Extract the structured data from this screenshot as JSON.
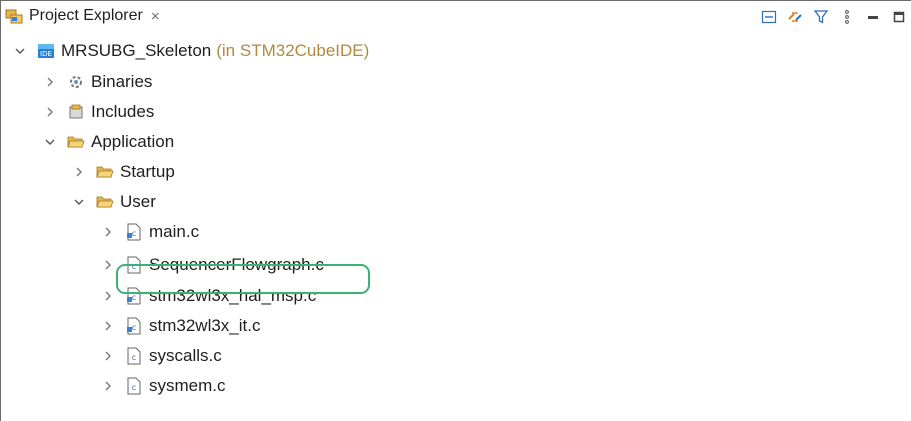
{
  "view": {
    "tab_label": "Project Explorer",
    "close_glyph": "×",
    "tab_icon": "project-explorer-icon",
    "toolbar": [
      "collapse-all-icon",
      "link-with-editor-icon",
      "filter-icon",
      "view-menu-icon",
      "minimize-icon",
      "maximize-icon"
    ]
  },
  "tree": {
    "project": {
      "label": "MRSUBG_Skeleton",
      "qualifier": "(in STM32CubeIDE)",
      "expanded": true
    },
    "items": [
      {
        "label": "Binaries",
        "icon": "binaries-icon",
        "expanded": false
      },
      {
        "label": "Includes",
        "icon": "includes-icon",
        "expanded": false
      },
      {
        "label": "Application",
        "icon": "folder-open-icon",
        "expanded": true
      },
      {
        "label": "Startup",
        "icon": "folder-open-icon",
        "expanded": false
      },
      {
        "label": "User",
        "icon": "folder-open-icon",
        "expanded": true
      },
      {
        "label": "main.c",
        "icon": "c-source-file-icon",
        "expanded": false
      },
      {
        "label": "SequencerFlowgraph.c",
        "icon": "c-file-icon",
        "expanded": false,
        "highlighted": true
      },
      {
        "label": "stm32wl3x_hal_msp.c",
        "icon": "c-source-file-icon",
        "expanded": false
      },
      {
        "label": "stm32wl3x_it.c",
        "icon": "c-source-file-icon",
        "expanded": false
      },
      {
        "label": "syscalls.c",
        "icon": "c-file-icon",
        "expanded": false
      },
      {
        "label": "sysmem.c",
        "icon": "c-file-icon",
        "expanded": false
      }
    ]
  },
  "colors": {
    "highlight_border": "#3bb273",
    "qualifier_text": "#b08a3e",
    "folder": "#e7b54a",
    "project_icon": "#2a7fd4"
  }
}
